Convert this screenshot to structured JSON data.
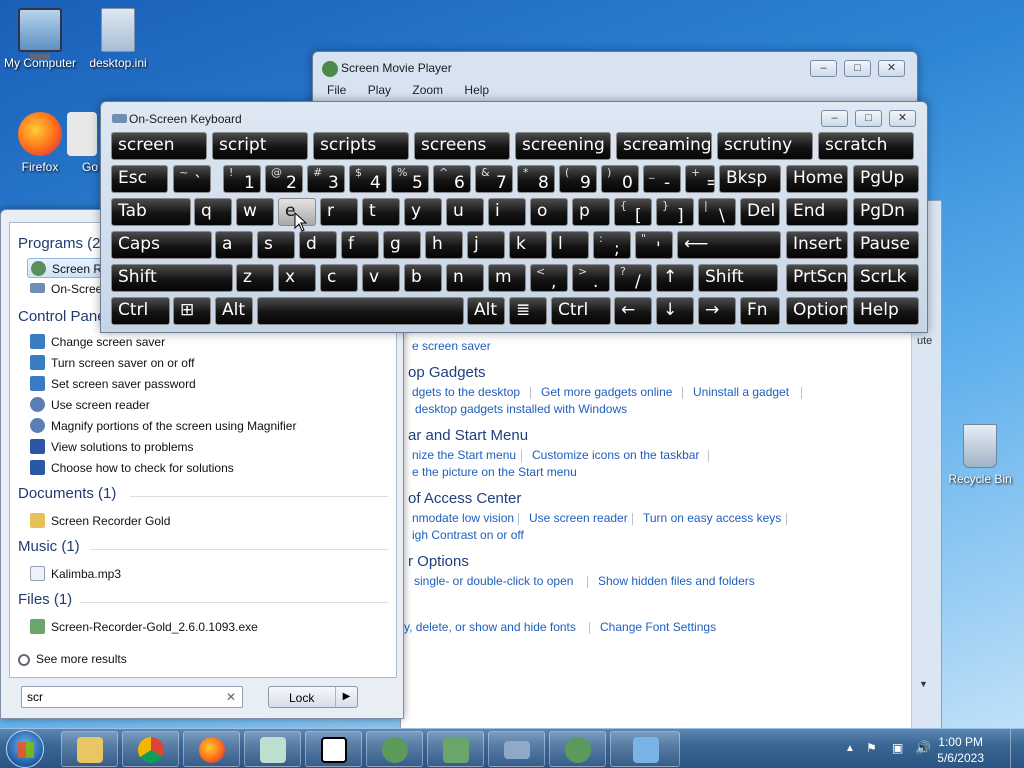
{
  "desktop": {
    "icons": [
      {
        "label": "My Computer",
        "icon": "computer-icon"
      },
      {
        "label": "desktop.ini",
        "icon": "file-icon"
      },
      {
        "label": "Firefox",
        "icon": "firefox-icon"
      },
      {
        "label": "Go",
        "icon": "google-icon"
      },
      {
        "label": "Recycle Bin",
        "icon": "recycle-bin-icon"
      }
    ]
  },
  "movie_player": {
    "title": "Screen Movie Player",
    "menu": [
      "File",
      "Play",
      "Zoom",
      "Help"
    ]
  },
  "osk": {
    "title": "On-Screen Keyboard",
    "suggestions": [
      "screen",
      "script",
      "scripts",
      "screens",
      "screening",
      "screaming",
      "scrutiny",
      "scratch"
    ],
    "row1": [
      {
        "top": "",
        "main": "Esc"
      },
      {
        "top": "~",
        "main": "`"
      },
      {
        "top": "!",
        "main": "1"
      },
      {
        "top": "@",
        "main": "2"
      },
      {
        "top": "#",
        "main": "3"
      },
      {
        "top": "$",
        "main": "4"
      },
      {
        "top": "%",
        "main": "5"
      },
      {
        "top": "^",
        "main": "6"
      },
      {
        "top": "&",
        "main": "7"
      },
      {
        "top": "*",
        "main": "8"
      },
      {
        "top": "(",
        "main": "9"
      },
      {
        "top": ")",
        "main": "0"
      },
      {
        "top": "_",
        "main": "-"
      },
      {
        "top": "+",
        "main": "="
      },
      {
        "top": "",
        "main": "Bksp"
      },
      {
        "top": "",
        "main": "Home"
      },
      {
        "top": "",
        "main": "PgUp"
      }
    ],
    "row2": [
      "Tab",
      "q",
      "w",
      "e",
      "r",
      "t",
      "y",
      "u",
      "i",
      "o",
      "p",
      "{ [",
      "} ]",
      "| \\",
      "Del",
      "End",
      "PgDn"
    ],
    "row3": [
      "Caps",
      "a",
      "s",
      "d",
      "f",
      "g",
      "h",
      "j",
      "k",
      "l",
      ": ;",
      "\" '",
      "⟵",
      "Insert",
      "Pause"
    ],
    "row4": [
      "Shift",
      "z",
      "x",
      "c",
      "v",
      "b",
      "n",
      "m",
      "< ,",
      "> .",
      "? /",
      "↑",
      "Shift",
      "PrtScn",
      "ScrLk"
    ],
    "row5": [
      "Ctrl",
      "⊞",
      "Alt",
      "",
      "Alt",
      "≣",
      "Ctrl",
      "←",
      "↓",
      "→",
      "Fn",
      "Options",
      "Help"
    ],
    "highlighted_key": "e"
  },
  "start_menu": {
    "groups": [
      {
        "header": "Programs (2)",
        "items": [
          "Screen Recorder Gold",
          "On-Screen Keyboard"
        ]
      },
      {
        "header": "Control Panel",
        "items": [
          "Change screen saver",
          "Turn screen saver on or off",
          "Set screen saver password",
          "Use screen reader",
          "Magnify portions of the screen using Magnifier",
          "View solutions to problems",
          "Choose how to check for solutions"
        ]
      },
      {
        "header": "Documents (1)",
        "items": [
          "Screen Recorder Gold"
        ]
      },
      {
        "header": "Music (1)",
        "items": [
          "Kalimba.mp3"
        ]
      },
      {
        "header": "Files (1)",
        "items": [
          "Screen-Recorder-Gold_2.6.0.1093.exe"
        ]
      }
    ],
    "see_more": "See more results",
    "search_value": "scr",
    "lock_label": "Lock"
  },
  "control_panel": {
    "first_link": "e screen saver",
    "sections": [
      {
        "title": "op Gadgets",
        "lines": [
          [
            "dgets to the desktop",
            "Get more gadgets online",
            "Uninstall a gadget"
          ],
          [
            "desktop gadgets installed with Windows"
          ]
        ]
      },
      {
        "title": "ar and Start Menu",
        "lines": [
          [
            "nize the Start menu",
            "Customize icons on the taskbar"
          ],
          [
            "e the picture on the Start menu"
          ]
        ]
      },
      {
        "title": "of Access Center",
        "lines": [
          [
            "nmodate low vision",
            "Use screen reader",
            "Turn on easy access keys"
          ],
          [
            "igh Contrast on or off"
          ]
        ]
      },
      {
        "title": "r Options",
        "lines": [
          [
            "single- or double-click to open",
            "Show hidden files and folders"
          ]
        ]
      },
      {
        "title": "",
        "lines": [
          [
            "y, delete, or show and hide fonts",
            "Change Font Settings"
          ]
        ]
      }
    ],
    "right_fragment": "ute"
  },
  "taskbar": {
    "apps": [
      "explorer-icon",
      "chrome-icon",
      "firefox-icon",
      "notepad-icon",
      "7zip-icon",
      "screen-movie-player-icon",
      "installer-icon",
      "on-screen-keyboard-icon",
      "screen-recorder-icon",
      "control-panel-icon"
    ],
    "time": "1:00 PM",
    "date": "5/6/2023"
  },
  "colors": {
    "desktop_top": "#1a5fb8",
    "link": "#1f5fbf",
    "key_bg": "#141414",
    "key_highlight": "#cfcfcf"
  }
}
